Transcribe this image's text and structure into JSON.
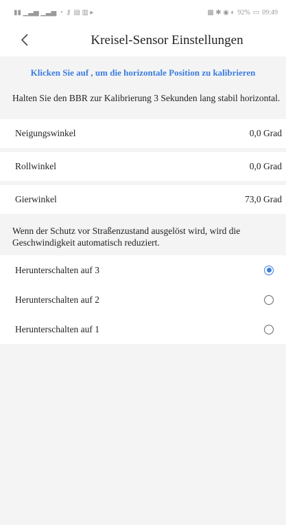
{
  "status_bar": {
    "left_icons": "sim-signal-wifi-icons",
    "right_text": "92%",
    "time": "09:49"
  },
  "header": {
    "title": "Kreisel-Sensor Einstellungen",
    "back_icon": "chevron-left-icon"
  },
  "calibration": {
    "link_text": "Klicken Sie auf , um die horizontale Position zu kalibrieren"
  },
  "hint": {
    "text": "Halten Sie den BBR zur Kalibrierung 3 Sekunden lang stabil horizontal."
  },
  "angles": [
    {
      "label": "Neigungswinkel",
      "value": "0,0 Grad"
    },
    {
      "label": "Rollwinkel",
      "value": "0,0 Grad"
    },
    {
      "label": "Gierwinkel",
      "value": "73,0 Grad"
    }
  ],
  "protection": {
    "text": "Wenn der Schutz vor Straßenzustand ausgelöst wird, wird die Geschwindigkeit automatisch reduziert."
  },
  "gears": [
    {
      "label": "Herunterschalten  auf 3",
      "selected": true
    },
    {
      "label": "Herunterschalten  auf 2",
      "selected": false
    },
    {
      "label": "Herunterschalten  auf 1",
      "selected": false
    }
  ],
  "colors": {
    "accent": "#3b7de0",
    "background": "#f4f4f4"
  }
}
